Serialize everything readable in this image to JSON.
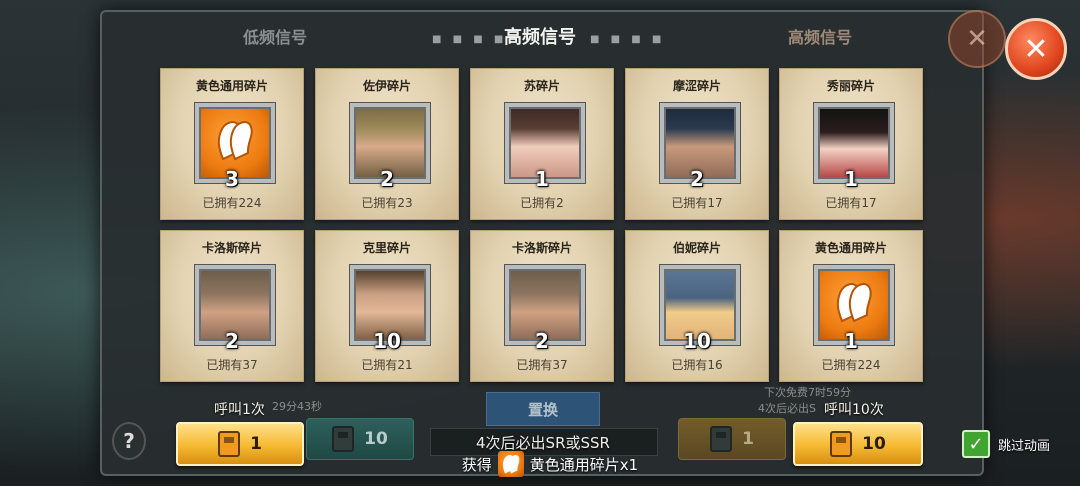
{
  "tabs": {
    "left": "低频信号",
    "center": "高频信号",
    "right": "高频信号"
  },
  "close_icon": "close-icon",
  "cards": [
    {
      "name": "黄色通用碎片",
      "count": "3",
      "owned": "已拥有224",
      "portrait": "p-orange",
      "icon": "fragment-icon"
    },
    {
      "name": "佐伊碎片",
      "count": "2",
      "owned": "已拥有23",
      "portrait": "p-army",
      "icon": "zoey-portrait"
    },
    {
      "name": "苏碎片",
      "count": "1",
      "owned": "已拥有2",
      "portrait": "p-fem",
      "icon": "su-portrait"
    },
    {
      "name": "摩涩碎片",
      "count": "2",
      "owned": "已拥有17",
      "portrait": "p-cap",
      "icon": "mose-portrait"
    },
    {
      "name": "秀丽碎片",
      "count": "1",
      "owned": "已拥有17",
      "portrait": "p-blackhair",
      "icon": "xiuli-portrait"
    },
    {
      "name": "卡洛斯碎片",
      "count": "2",
      "owned": "已拥有37",
      "portrait": "p-face",
      "icon": "carlos-portrait"
    },
    {
      "name": "克里碎片",
      "count": "10",
      "owned": "已拥有21",
      "portrait": "p-bald",
      "icon": "keli-portrait"
    },
    {
      "name": "卡洛斯碎片",
      "count": "2",
      "owned": "已拥有37",
      "portrait": "p-face",
      "icon": "carlos-portrait"
    },
    {
      "name": "伯妮碎片",
      "count": "10",
      "owned": "已拥有16",
      "portrait": "p-helm",
      "icon": "bonnie-portrait"
    },
    {
      "name": "黄色通用碎片",
      "count": "1",
      "owned": "已拥有224",
      "portrait": "p-orange",
      "icon": "fragment-icon"
    }
  ],
  "call_once": {
    "label": "呼叫1次",
    "cost": "1"
  },
  "call_ten": {
    "label": "呼叫10次",
    "cost": "10"
  },
  "ghost_left": {
    "cost_teal": "10",
    "timer": "29分43秒"
  },
  "ghost_right": {
    "cost_dim": "1",
    "free_next": "下次免费7时59分",
    "guarantee": "4次后必出S"
  },
  "middle": {
    "replace_label": "置换",
    "guarantee": "4次后必出SR或SSR"
  },
  "reward": {
    "prefix": "获得",
    "item": "黄色通用碎片x1"
  },
  "skip": {
    "label": "跳过动画",
    "checked": true
  },
  "help_icon": "?",
  "colors": {
    "accent_orange": "#f29a1e",
    "gold_button": "#f5b932",
    "close_red": "#e0451e"
  }
}
